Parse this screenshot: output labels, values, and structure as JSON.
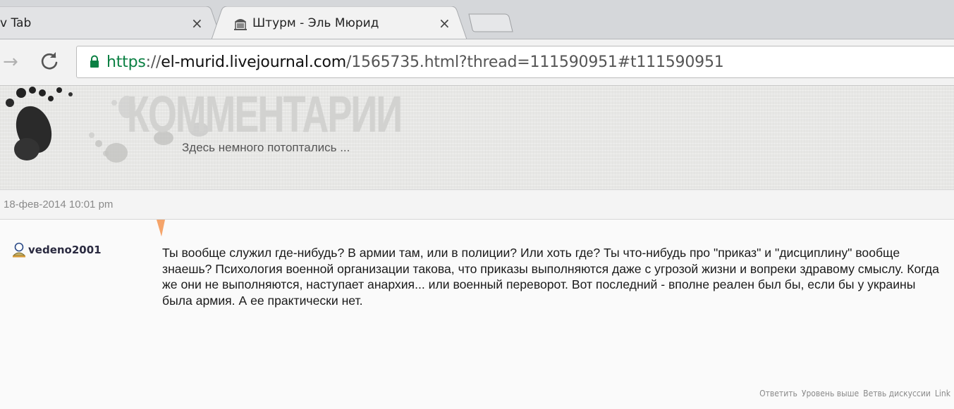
{
  "browser": {
    "tabs": [
      {
        "title": "v Tab",
        "close": "×",
        "active": false
      },
      {
        "title": "Штурм - Эль Мюрид",
        "close": "×",
        "active": true
      }
    ],
    "toolbar": {
      "forward_glyph": "→",
      "url": {
        "scheme": "https",
        "separator": "://",
        "host": "el-murid.livejournal.com",
        "path": "/1565735.html?thread=111590951#t111590951"
      }
    },
    "colors": {
      "secure_green": "#0b8043",
      "accent_orange": "#f5a46a"
    }
  },
  "header": {
    "title": "КОММЕНТАРИИ",
    "subtitle": "Здесь немного потоптались ..."
  },
  "comment": {
    "date": "18-фев-2014 10:01 pm",
    "author": "vedeno2001",
    "text": "Ты вообще служил где-нибудь? В армии там, или в полиции? Или хоть где? Ты что-нибудь про \"приказ\" и \"дисциплину\" вообще знаешь? Психология военной организации такова, что приказы выполняются даже с угрозой жизни и вопреки здравому смыслу. Когда же они не выполняются, наступает анархия... или военный переворот. Вот последний - вполне реален был бы, если бы у украины была армия. А ее практически нет.",
    "actions": {
      "reply": "Ответить",
      "parent": "Уровень выше",
      "thread": "Ветвь дискуссии",
      "link": "Link"
    }
  }
}
